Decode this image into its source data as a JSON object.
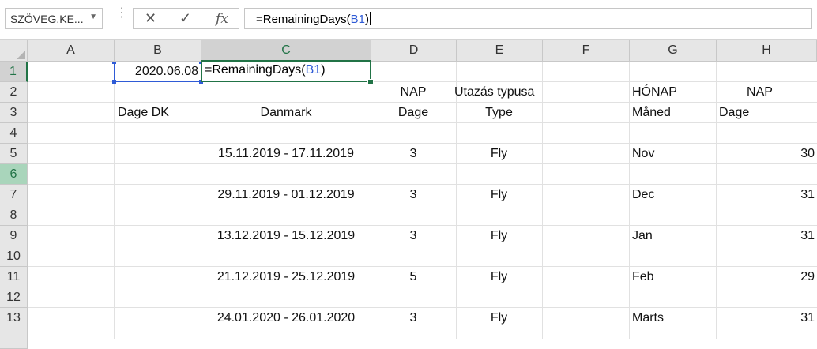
{
  "formula_bar": {
    "name_box": "SZÖVEG.KE...",
    "cancel_icon": "✕",
    "enter_icon": "✓",
    "fx_label": "fx",
    "formula_prefix": "=RemainingDays(",
    "formula_ref": "B1",
    "formula_suffix": ")"
  },
  "columns": [
    "A",
    "B",
    "C",
    "D",
    "E",
    "F",
    "G",
    "H"
  ],
  "rows": [
    "1",
    "2",
    "3",
    "4",
    "5",
    "6",
    "7",
    "8",
    "9",
    "10",
    "11",
    "12",
    "13"
  ],
  "cells": {
    "B1": "2020.06.08",
    "C1_prefix": "=RemainingDays(",
    "C1_ref": "B1",
    "C1_suffix": ")",
    "D2": "NAP",
    "E2": "Utazás typusa",
    "G2": "HÓNAP",
    "H2": "NAP",
    "B3": "Dage DK",
    "C3": "Danmark",
    "D3": "Dage",
    "E3": "Type",
    "G3": "Måned",
    "H3": "Dage",
    "C5": "15.11.2019 - 17.11.2019",
    "D5": "3",
    "E5": "Fly",
    "G5": "Nov",
    "H5": "30",
    "C7": "29.11.2019 - 01.12.2019",
    "D7": "3",
    "E7": "Fly",
    "G7": "Dec",
    "H7": "31",
    "C9": "13.12.2019 - 15.12.2019",
    "D9": "3",
    "E9": "Fly",
    "G9": "Jan",
    "H9": "31",
    "C11": "21.12.2019 - 25.12.2019",
    "D11": "5",
    "E11": "Fly",
    "G11": "Feb",
    "H11": "29",
    "C13": "24.01.2020 - 26.01.2020",
    "D13": "3",
    "E13": "Fly",
    "G13": "Marts",
    "H13": "31"
  },
  "colors": {
    "excel_green": "#217346",
    "ref_blue": "#2f5bd6",
    "header_bg": "#e6e6e6",
    "selected_row_bg": "#a9d5bb"
  }
}
